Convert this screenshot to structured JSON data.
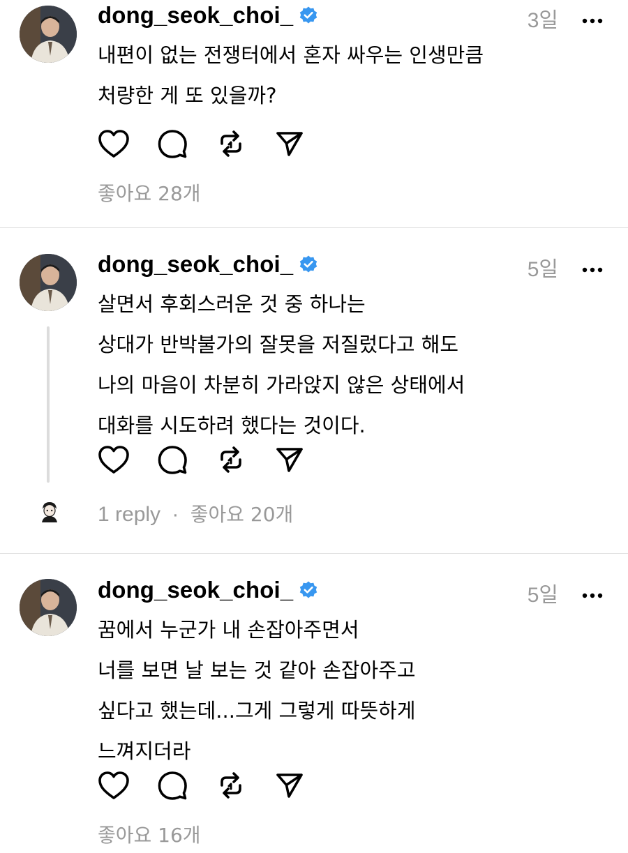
{
  "posts": [
    {
      "username": "dong_seok_choi_",
      "time": "3일",
      "lines": [
        "내편이 없는 전쟁터에서 혼자 싸우는 인생만큼",
        "처량한 게 또 있을까?"
      ],
      "meta": {
        "likes": "좋아요 28개"
      }
    },
    {
      "username": "dong_seok_choi_",
      "time": "5일",
      "lines": [
        "살면서 후회스러운 것 중 하나는",
        "상대가 반박불가의 잘못을 저질렀다고 해도",
        "나의 마음이 차분히 가라앉지 않은 상태에서",
        "대화를 시도하려 했다는 것이다."
      ],
      "meta": {
        "replies": "1 reply",
        "separator": "·",
        "likes": "좋아요 20개"
      }
    },
    {
      "username": "dong_seok_choi_",
      "time": "5일",
      "lines": [
        "꿈에서 누군가 내 손잡아주면서",
        "너를 보면 날 보는 것 같아 손잡아주고",
        "싶다고 했는데...그게 그렇게 따뜻하게",
        "느껴지더라"
      ],
      "meta": {
        "likes": "좋아요 16개"
      }
    }
  ],
  "icons": {
    "like": "heart-icon",
    "comment": "comment-bubble-icon",
    "repost": "repost-icon",
    "share": "send-icon",
    "verified": "verified-badge-icon",
    "more": "more-horizontal-icon"
  },
  "colors": {
    "verified": "#3897f0",
    "muted": "#999999",
    "divider": "#e0e0e0"
  }
}
